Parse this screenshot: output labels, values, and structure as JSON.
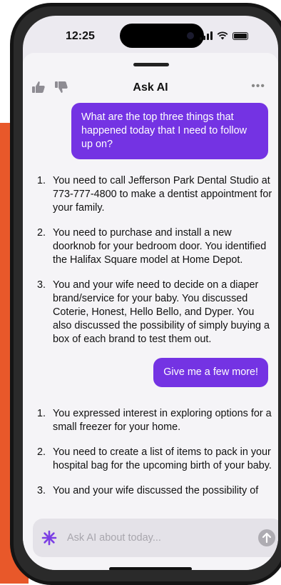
{
  "status": {
    "time": "12:25"
  },
  "header": {
    "title": "Ask AI",
    "more_label": "•••"
  },
  "messages": {
    "user_1": "What are the top three things that happened today that I need to follow up on?",
    "ai_1": [
      {
        "num": "1.",
        "text": "You need to call Jefferson Park Dental Studio at 773-777-4800 to make a dentist appointment for your family."
      },
      {
        "num": "2.",
        "text": "You need to purchase and install a new doorknob for your bedroom door. You identified the Halifax Square model at Home Depot."
      },
      {
        "num": "3.",
        "text": "You and your wife need to decide on a diaper brand/service for your baby. You discussed Coterie, Honest, Hello Bello, and Dyper. You also discussed the possibility of simply buying a box of each brand to test them out."
      }
    ],
    "user_2": "Give me a few more!",
    "ai_2": [
      {
        "num": "1.",
        "text": "You expressed interest in exploring options for a small freezer for your home."
      },
      {
        "num": "2.",
        "text": "You need to create a list of items to pack in your hospital bag for the upcoming birth of your baby."
      },
      {
        "num": "3.",
        "text": "You and your wife discussed the possibility of"
      }
    ]
  },
  "input": {
    "placeholder": "Ask AI about today..."
  },
  "colors": {
    "accent": "#7433e3",
    "background_orange": "#e8582a"
  },
  "icons": {
    "thumbs_up": "thumbs-up-icon",
    "thumbs_down": "thumbs-down-icon",
    "sparkle": "sparkle-icon",
    "send": "arrow-up-icon"
  }
}
